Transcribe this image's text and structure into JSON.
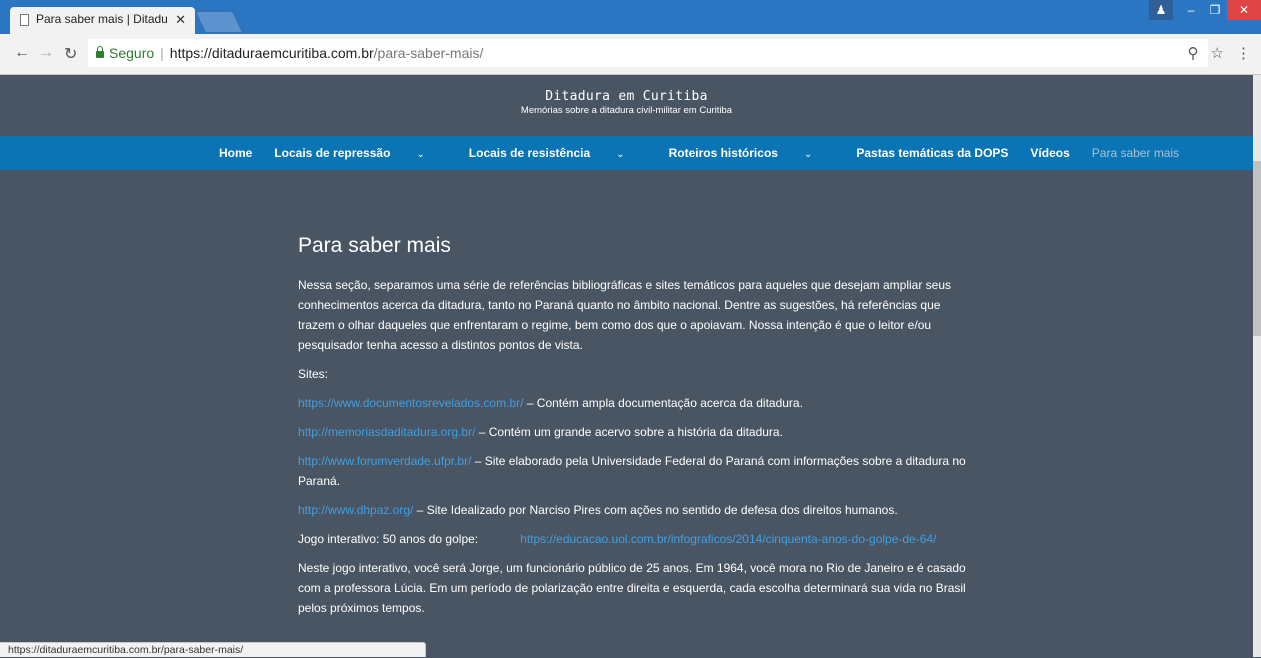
{
  "browser": {
    "tab_title": "Para saber mais | Ditadu",
    "tab_close": "✕",
    "secure_label": "Seguro",
    "url_host": "https://ditaduraemcuritiba.com.br",
    "url_path": "/para-saber-mais/",
    "status_url": "https://ditaduraemcuritiba.com.br/para-saber-mais/"
  },
  "site": {
    "title": "Ditadura em Curitiba",
    "subtitle": "Memórias sobre a ditadura civil-militar em Curitiba"
  },
  "nav": {
    "items": [
      {
        "label": "Home"
      },
      {
        "label": "Locais de repressão",
        "has_dropdown": true
      },
      {
        "label": "Locais de resistência",
        "has_dropdown": true
      },
      {
        "label": "Roteiros históricos",
        "has_dropdown": true
      },
      {
        "label": "Pastas temáticas da DOPS"
      },
      {
        "label": "Vídeos"
      },
      {
        "label": "Para saber mais",
        "active": true
      }
    ]
  },
  "page": {
    "heading": "Para saber mais",
    "intro": "Nessa seção, separamos uma série de referências bibliográficas e sites temáticos para aqueles que desejam ampliar seus conhecimentos acerca da ditadura, tanto no Paraná quanto no âmbito nacional. Dentre as sugestões, há referências que trazem o olhar daqueles que enfrentaram o regime, bem como dos que o apoiavam. Nossa intenção é que o leitor e/ou pesquisador tenha acesso a distintos pontos de vista.",
    "sites_label": "Sites:",
    "sites": [
      {
        "url": "https://www.documentosrevelados.com.br/",
        "desc": " – Contém ampla documentação acerca da ditadura."
      },
      {
        "url": "http://memoriasdaditadura.org.br/",
        "desc": "  – Contém um grande acervo sobre a história da ditadura."
      },
      {
        "url": "http://www.forumverdade.ufpr.br/",
        "desc": " – Site elaborado pela Universidade Federal do Paraná com informações sobre a ditadura no Paraná."
      },
      {
        "url": "http://www.dhpaz.org/",
        "desc": "  – Site Idealizado por Narciso Pires com ações no sentido de defesa dos direitos humanos."
      }
    ],
    "game_label": "Jogo interativo: 50 anos do golpe:",
    "game_url": "https://educacao.uol.com.br/infograficos/2014/cinquenta-anos-do-golpe-de-64/",
    "game_desc": "Neste jogo interativo, você será Jorge, um funcionário público de 25 anos. Em 1964, você mora no Rio de Janeiro e é casado com a professora Lúcia. Em um período de polarização entre direita e esquerda, cada escolha determinará sua vida no Brasil pelos próximos tempos."
  },
  "colors": {
    "page_bg": "#4a5563",
    "nav_bg": "#0a74b4",
    "link": "#3ea0e4",
    "chrome_blue": "#2b76c2"
  }
}
